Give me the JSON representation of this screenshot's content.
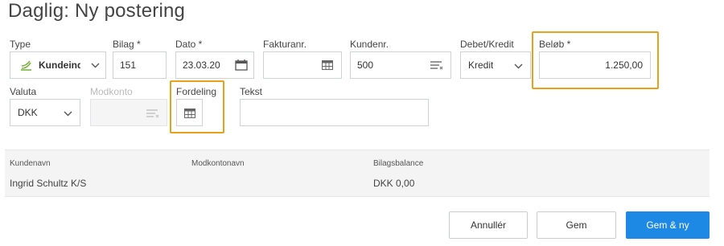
{
  "page": {
    "title": "Daglig: Ny postering"
  },
  "fields": {
    "type": {
      "label": "Type",
      "value": "Kundeind"
    },
    "bilag": {
      "label": "Bilag *",
      "value": "151"
    },
    "dato": {
      "label": "Dato *",
      "value": "23.03.20"
    },
    "fakturanr": {
      "label": "Fakturanr.",
      "value": ""
    },
    "kundenr": {
      "label": "Kundenr.",
      "value": "500"
    },
    "debet_kredit": {
      "label": "Debet/Kredit",
      "value": "Kredit"
    },
    "belob": {
      "label": "Beløb *",
      "value": "1.250,00"
    },
    "valuta": {
      "label": "Valuta",
      "value": "DKK"
    },
    "modkonto": {
      "label": "Modkonto",
      "value": ""
    },
    "fordeling": {
      "label": "Fordeling"
    },
    "tekst": {
      "label": "Tekst",
      "value": ""
    }
  },
  "summary": {
    "kundenavn": {
      "label": "Kundenavn",
      "value": "Ingrid Schultz K/S"
    },
    "modkontonavn": {
      "label": "Modkontonavn",
      "value": ""
    },
    "bilagsbalance": {
      "label": "Bilagsbalance",
      "value": "DKK 0,00"
    }
  },
  "buttons": {
    "cancel": "Annullér",
    "save": "Gem",
    "save_new": "Gem & ny"
  },
  "colors": {
    "accent": "#1e88e5",
    "highlight": "#e8a11a"
  }
}
